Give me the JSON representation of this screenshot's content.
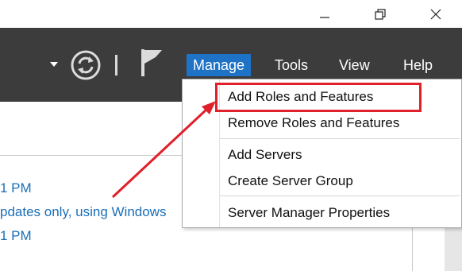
{
  "window": {
    "minimize_icon": "minimize-icon",
    "restore_icon": "restore-icon",
    "close_icon": "close-icon"
  },
  "toolbar": {
    "refresh_icon": "refresh-icon",
    "flag_icon": "flag-icon",
    "menus": [
      {
        "label": "Manage",
        "active": true
      },
      {
        "label": "Tools",
        "active": false
      },
      {
        "label": "View",
        "active": false
      },
      {
        "label": "Help",
        "active": false
      }
    ],
    "active_color": "#1e73c7",
    "background_color": "#3c3c3c"
  },
  "content": {
    "lines": [
      "1 PM",
      "pdates only, using Windows",
      "1 PM"
    ],
    "link_color": "#1a6fb8"
  },
  "manage_menu": {
    "items": [
      {
        "label": "Add Roles and Features"
      },
      {
        "label": "Remove Roles and Features"
      },
      {
        "label": "Add Servers"
      },
      {
        "label": "Create Server Group"
      },
      {
        "label": "Server Manager Properties"
      }
    ],
    "highlight_color": "#e0202a"
  }
}
